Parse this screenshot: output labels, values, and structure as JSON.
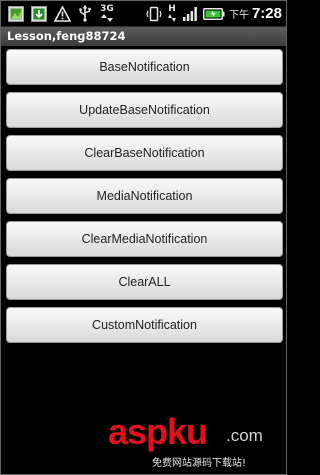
{
  "status_bar": {
    "icons_left": [
      "image-icon",
      "download-icon",
      "warning-icon",
      "usb-icon"
    ],
    "network_label": "3G",
    "network_h_label": "H",
    "time_prefix": "下午",
    "time": "7:28"
  },
  "title_bar": {
    "title": "Lesson,feng88724"
  },
  "buttons": [
    {
      "label": "BaseNotification"
    },
    {
      "label": "UpdateBaseNotification"
    },
    {
      "label": "ClearBaseNotification"
    },
    {
      "label": "MediaNotification"
    },
    {
      "label": "ClearMediaNotification"
    },
    {
      "label": "ClearALL"
    },
    {
      "label": "CustomNotification"
    }
  ],
  "watermark": {
    "logo": "aspku",
    "domain": ".com",
    "subtitle": "免费网站源码下载站!"
  },
  "colors": {
    "background": "#000000",
    "title_bar": "#4a4a4a",
    "button_face": "#e6e6e6",
    "watermark_red": "#e3101c",
    "battery_green": "#3cc43c"
  }
}
